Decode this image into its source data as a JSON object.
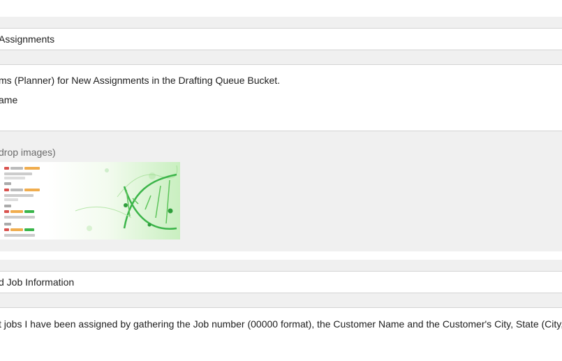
{
  "sections": {
    "first_title": "Assignments",
    "first_body_line1": "ms (Planner) for New Assignments in the Drafting Queue Bucket.",
    "first_body_line2": "ame",
    "images_hint": "drop images)",
    "second_title": "d Job Information",
    "second_body_line1": "t jobs I have been assigned by gathering the Job number (00000 format), the Customer Name and the Customer's City, State (City, S"
  },
  "icons": {
    "thumbnail_1": "planner-board-thumbnail",
    "thumbnail_2": "dna-helix-thumbnail"
  },
  "colors": {
    "page_bg": "#f0f0f0",
    "field_bg": "#ffffff",
    "border": "#d4d4d4",
    "accent_green": "#39b54a"
  }
}
